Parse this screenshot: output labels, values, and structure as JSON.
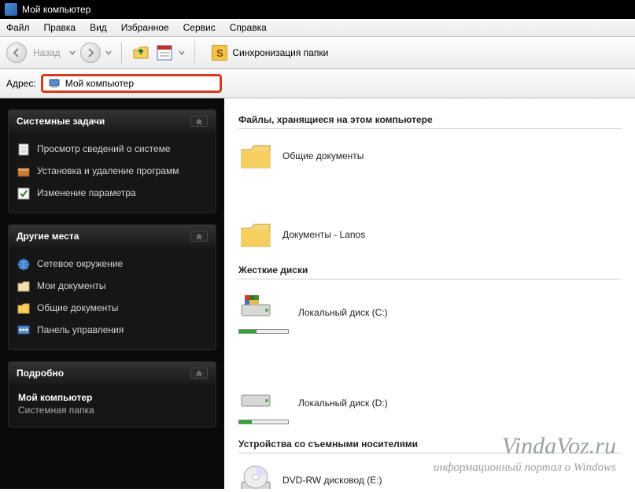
{
  "window": {
    "title": "Мой компьютер"
  },
  "menu": {
    "file": "Файл",
    "edit": "Правка",
    "view": "Вид",
    "favorites": "Избранное",
    "tools": "Сервис",
    "help": "Справка"
  },
  "toolbar": {
    "back_label": "Назад",
    "sync_label": "Синхронизация папки",
    "sync_glyph": "S"
  },
  "address": {
    "label": "Адрес:",
    "value": "Мой компьютер"
  },
  "sidebar": {
    "tasks": {
      "header": "Системные задачи",
      "items": {
        "view_info": "Просмотр сведений о системе",
        "add_remove": "Установка и удаление программ",
        "change_setting": "Изменение параметра"
      }
    },
    "places": {
      "header": "Другие места",
      "items": {
        "network": "Сетевое окружение",
        "my_docs": "Мои документы",
        "shared_docs": "Общие документы",
        "control_panel": "Панель управления"
      }
    },
    "details": {
      "header": "Подробно",
      "title": "Мой компьютер",
      "subtitle": "Системная папка"
    }
  },
  "content": {
    "section1": "Файлы, хранящиеся на этом компьютере",
    "shared_docs": "Общие документы",
    "user_docs": "Документы - Lanos",
    "section2": "Жесткие диски",
    "disk_c": "Локальный диск (C:)",
    "disk_d": "Локальный диск (D:)",
    "section3": "Устройства со съемными носителями",
    "dvd": "DVD-RW дисковод (E:)"
  },
  "watermark": {
    "title": "VindaVoz.ru",
    "subtitle": "информационный портал о Windows"
  }
}
